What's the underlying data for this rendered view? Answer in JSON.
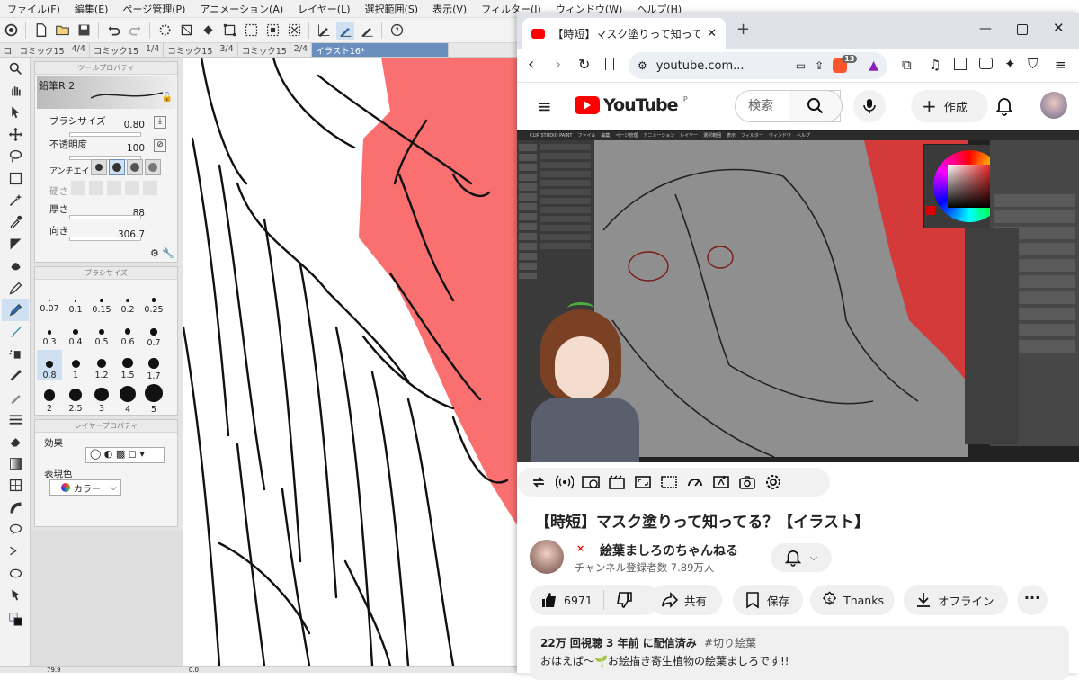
{
  "csp": {
    "menus": [
      "ファイル(F)",
      "編集(E)",
      "ページ管理(P)",
      "アニメーション(A)",
      "レイヤー(L)",
      "選択範囲(S)",
      "表示(V)",
      "フィルター(I)",
      "ウィンドウ(W)",
      "ヘルプ(H)"
    ],
    "tabs": [
      {
        "a": "コ",
        "b": "コミック15",
        "c": "4/4"
      },
      {
        "a": "コミック15",
        "b": "1/4"
      },
      {
        "a": "コミック15",
        "b": "3/4"
      },
      {
        "a": "コミック15",
        "b": "2/4"
      }
    ],
    "active_tab": "イラスト16*",
    "tool_property": {
      "title": "ツールプロパティ",
      "brush_name": "鉛筆R 2",
      "brush_size_label": "ブラシサイズ",
      "brush_size_value": "0.80",
      "opacity_label": "不透明度",
      "opacity_value": "100",
      "antialias_label": "アンチエイリアス",
      "hardness_label": "硬さ",
      "thickness_label": "厚さ",
      "thickness_value": "88",
      "direction_label": "向き",
      "direction_value": "306.7"
    },
    "brush_size_panel": {
      "title": "ブラシサイズ",
      "sizes": [
        "0.07",
        "0.1",
        "0.15",
        "0.2",
        "0.25",
        "0.3",
        "0.4",
        "0.5",
        "0.6",
        "0.7",
        "0.8",
        "1",
        "1.2",
        "1.5",
        "1.7",
        "2",
        "2.5",
        "3",
        "4",
        "5"
      ],
      "selected": "0.8"
    },
    "layer_property": {
      "title": "レイヤープロパティ",
      "effect_label": "効果",
      "color_label": "表現色",
      "color_value": "カラー"
    },
    "status": {
      "zoom": "79.9",
      "angle": "0.0"
    }
  },
  "browser": {
    "tab_title": "【時短】マスク塗りって知ってる？【イラスト】",
    "new_tab": "+",
    "url": "youtube.com...",
    "brave_badge": "13",
    "youtube": {
      "logo_text": "YouTube",
      "region": "JP",
      "search_placeholder": "検索",
      "create_label": "作成"
    },
    "video_title": "【時短】マスク塗りって知ってる？【イラスト】",
    "channel_name": "絵葉ましろのちゃんねる",
    "subscribers": "チャンネル登録者数 7.89万人",
    "actions": {
      "likes": "6971",
      "share": "共有",
      "save": "保存",
      "thanks": "Thanks",
      "offline": "オフライン"
    },
    "description": {
      "meta": "22万 回視聴  3 年前 に配信済み",
      "tag": "#切り絵葉",
      "line": "おはえば〜🌱お絵描き寄生植物の絵葉ましろです!!"
    },
    "video_inner": {
      "menu": [
        "CLIP STUDIO PAINT",
        "ファイル",
        "編集",
        "ページ管理",
        "アニメーション",
        "レイヤー",
        "選択範囲",
        "表示",
        "フィルター",
        "ウィンドウ",
        "ヘルプ"
      ]
    }
  },
  "colors": {
    "canvas_red": "#fa6f6f",
    "youtube_red": "#ff0000",
    "video_red": "#d43a3a",
    "selected_blue": "#cfe0f3"
  }
}
